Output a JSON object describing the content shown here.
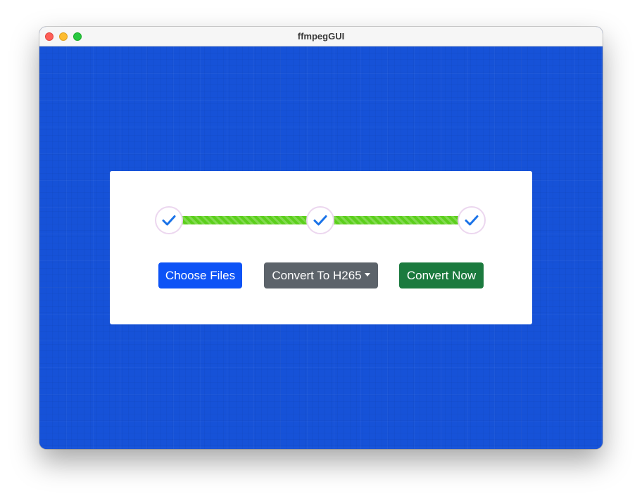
{
  "window": {
    "title": "ffmpegGUI"
  },
  "stepper": {
    "steps": [
      {
        "state": "complete",
        "icon": "check-icon"
      },
      {
        "state": "complete",
        "icon": "check-icon"
      },
      {
        "state": "complete",
        "icon": "check-icon"
      }
    ],
    "progress_percent": 100,
    "colors": {
      "bar": "#5ccf1c",
      "check": "#1a73e8",
      "circle_border": "#ecd7ef"
    }
  },
  "buttons": {
    "choose_files": "Choose Files",
    "convert_to": "Convert To H265",
    "convert_now": "Convert Now"
  },
  "colors": {
    "background": "#1652d8",
    "choose_files": "#0d53f6",
    "convert_to": "#5c636a",
    "convert_now": "#1b7a3e"
  }
}
